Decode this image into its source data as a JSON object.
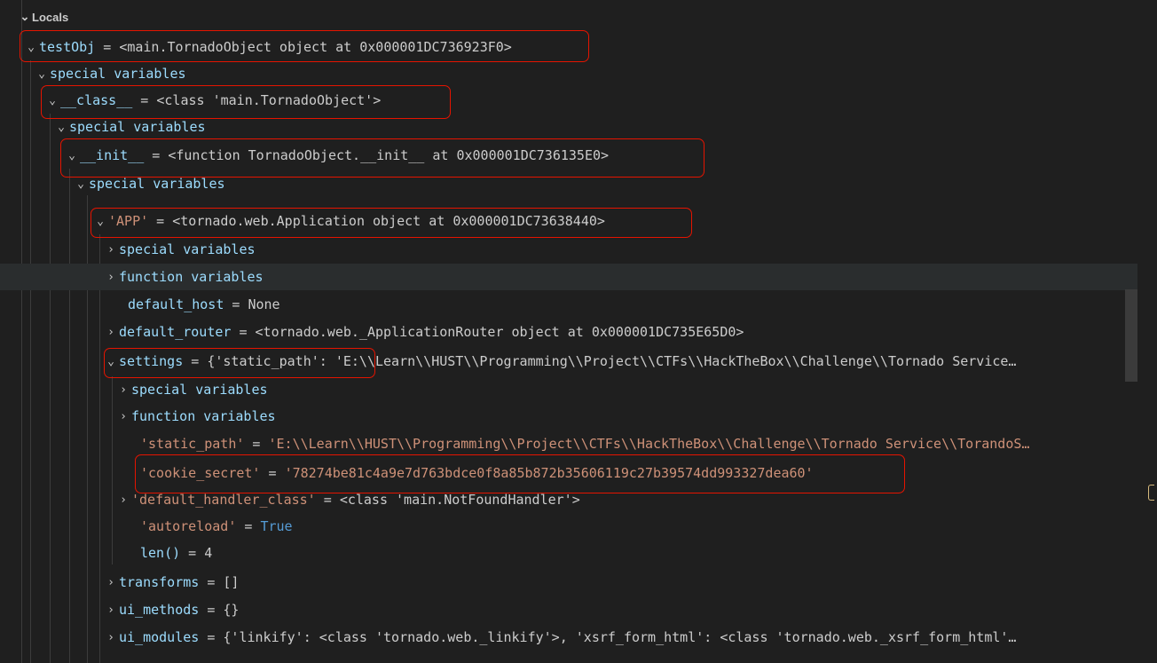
{
  "panel": {
    "section_title": "Locals"
  },
  "rows": [
    {
      "id": "testObj",
      "name": "testObj",
      "value": "<main.TornadoObject object at 0x000001DC736923F0>"
    },
    {
      "id": "special1",
      "label": "special variables"
    },
    {
      "id": "class",
      "name": "__class__",
      "value": "<class 'main.TornadoObject'>"
    },
    {
      "id": "special2",
      "label": "special variables"
    },
    {
      "id": "init",
      "name": "__init__",
      "value": "<function TornadoObject.__init__ at 0x000001DC736135E0>"
    },
    {
      "id": "special3",
      "label": "special variables"
    },
    {
      "id": "app",
      "name": "'APP'",
      "value": "<tornado.web.Application object at 0x000001DC73638440>"
    },
    {
      "id": "app_special",
      "label": "special variables"
    },
    {
      "id": "app_function",
      "label": "function variables"
    },
    {
      "id": "default_host",
      "name": "default_host",
      "value": "None"
    },
    {
      "id": "default_router",
      "name": "default_router",
      "value": "<tornado.web._ApplicationRouter object at 0x000001DC735E65D0>"
    },
    {
      "id": "settings",
      "name": "settings",
      "value": "{'static_path': 'E:\\\\Learn\\\\HUST\\\\Programming\\\\Project\\\\CTFs\\\\HackTheBox\\\\Challenge\\\\Tornado Service…"
    },
    {
      "id": "settings_special",
      "label": "special variables"
    },
    {
      "id": "settings_function",
      "label": "function variables"
    },
    {
      "id": "static_path",
      "name": "'static_path'",
      "value": "'E:\\\\Learn\\\\HUST\\\\Programming\\\\Project\\\\CTFs\\\\HackTheBox\\\\Challenge\\\\Tornado Service\\\\TorandoS…"
    },
    {
      "id": "cookie_secret",
      "name": "'cookie_secret'",
      "value": "'78274be81c4a9e7d763bdce0f8a85b872b35606119c27b39574dd993327dea60'"
    },
    {
      "id": "default_handler_class",
      "name": "'default_handler_class'",
      "value": "<class 'main.NotFoundHandler'>"
    },
    {
      "id": "autoreload",
      "name": "'autoreload'",
      "value": "True"
    },
    {
      "id": "len",
      "name": "len()",
      "value": "4"
    },
    {
      "id": "transforms",
      "name": "transforms",
      "value": "[]"
    },
    {
      "id": "ui_methods",
      "name": "ui_methods",
      "value": "{}"
    },
    {
      "id": "ui_modules",
      "name": "ui_modules",
      "value": "{'linkify': <class 'tornado.web._linkify'>, 'xsrf_form_html': <class 'tornado.web._xsrf_form_html'…"
    }
  ],
  "colors": {
    "background": "#1f1f1f",
    "name": "#9cdcfe",
    "string": "#ce9178",
    "keyword": "#569cd6",
    "highlight": "#e51400"
  },
  "icons": {
    "expanded": "chevron-down-icon",
    "collapsed": "chevron-right-icon"
  }
}
